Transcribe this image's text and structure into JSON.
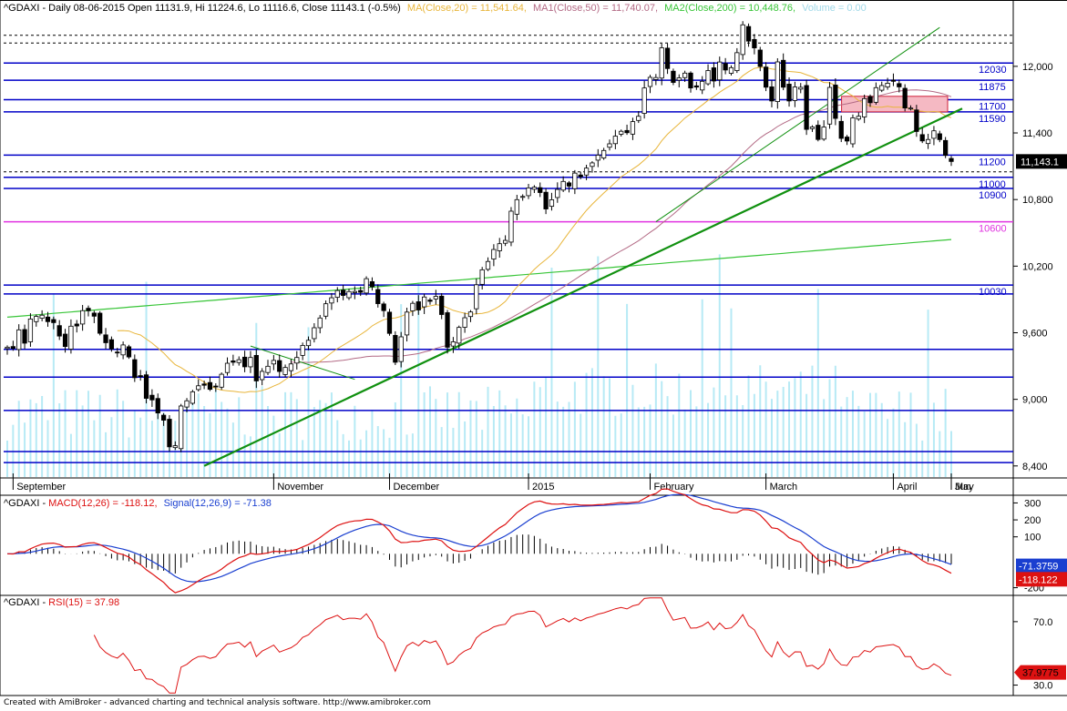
{
  "colors": {
    "up": "#ffffff",
    "down": "#000000",
    "ma20": "#e8b53a",
    "ma50": "#b36a85",
    "ma200": "#38c538",
    "volume": "#b7eaf5",
    "hline": "#0000c8",
    "magenta": "#e032e0",
    "trend": "#10900f",
    "zone": "#f5b9c3",
    "zone_border": "#d0203a",
    "macd": "#dd1111",
    "signal": "#1a3fd0",
    "rsi": "#dd1111"
  },
  "header": {
    "symbol": "^GDAXI - Daily 08-06-2015 Open 11131.9, Hi 11224.6, Lo 11116.6, Close 11143.1 (-0.5%)",
    "ma20": "MA(Close,20) = 11,541.64,",
    "ma50": "MA1(Close,50) = 11,740.07,",
    "ma200": "MA2(Close,200) = 10,448.76,",
    "volume": "Volume = 0.00"
  },
  "macd_header": {
    "prefix": "^GDAXI - ",
    "macd": "MACD(12,26) = -118.12,",
    "signal": "Signal(12,26,9) = -71.38"
  },
  "rsi_header": {
    "prefix": "^GDAXI - ",
    "rsi": "RSI(15) = 37.98"
  },
  "footer": "Created with AmiBroker - advanced charting and technical analysis software. http://www.amibroker.com",
  "chart_data": [
    {
      "type": "candlestick",
      "title": "^GDAXI - Daily 08-06-2015",
      "ylim": [
        8300,
        12450
      ],
      "y_ticks": [
        8400,
        9000,
        9600,
        10200,
        10800,
        11400,
        12000
      ],
      "y_tick_labels": [
        "8,400",
        "9,000",
        "9,600",
        "10,200",
        "10,800",
        "11,400",
        "12,000"
      ],
      "x_labels": [
        "September",
        "November",
        "December",
        "2015",
        "February",
        "March",
        "April",
        "May",
        "Jun"
      ],
      "last_price_label": "11,143.1",
      "last_price": 11143.1,
      "support_resistance": [
        {
          "value": 12030,
          "label": "12030"
        },
        {
          "value": 11875,
          "label": "11875"
        },
        {
          "value": 11700,
          "label": "11700"
        },
        {
          "value": 11590,
          "label": "11590"
        },
        {
          "value": 11200,
          "label": "11200"
        },
        {
          "value": 11000,
          "label": "11000"
        },
        {
          "value": 10900,
          "label": "10900"
        },
        {
          "value": 10600,
          "label": "10600"
        },
        {
          "value": 10030,
          "label": "10030"
        },
        {
          "value": 9950,
          "label": ""
        },
        {
          "value": 9450,
          "label": ""
        },
        {
          "value": 9200,
          "label": ""
        },
        {
          "value": 8900,
          "label": ""
        },
        {
          "value": 8530,
          "label": ""
        },
        {
          "value": 8430,
          "label": ""
        }
      ],
      "zone": [
        11590,
        11730
      ],
      "trendline": {
        "from": {
          "date": "2014-10-16",
          "value": 8400
        },
        "to": {
          "date": "2015-06-08",
          "value": 11570
        }
      },
      "trendline2": {
        "from": {
          "date": "2015-02-03",
          "value": 10600
        },
        "to": {
          "date": "2015-04-13",
          "value": 12350
        }
      },
      "closes_start": "2014-08-29",
      "closes": [
        9470,
        9459,
        9626,
        9506,
        9724,
        9747,
        9758,
        9700,
        9691,
        9570,
        9476,
        9659,
        9661,
        9799,
        9798,
        9749,
        9595,
        9510,
        9454,
        9422,
        9490,
        9382,
        9195,
        9209,
        9009,
        8995,
        8877,
        8812,
        8572,
        8582,
        8940,
        8987,
        9068,
        9122,
        9127,
        9090,
        9114,
        9226,
        9325,
        9334,
        9357,
        9293,
        9377,
        9166,
        9252,
        9298,
        9351,
        9251,
        9287,
        9319,
        9377,
        9486,
        9532,
        9645,
        9733,
        9861,
        9915,
        9980,
        9936,
        9971,
        9972,
        9964,
        10087,
        10014,
        9862,
        9799,
        9594,
        9334,
        9563,
        9786,
        9865,
        9805,
        9922,
        9883,
        9927,
        9764,
        9469,
        9518,
        9648,
        9735,
        9787,
        10032,
        10167,
        10242,
        10350,
        10402,
        10432,
        10695,
        10799,
        10828,
        10905,
        10911,
        10863,
        10715,
        10798,
        10891,
        10963,
        10921,
        11038,
        11005,
        11083,
        11130,
        11200,
        11242,
        11302,
        11371,
        11415,
        11402,
        11502,
        11550,
        11805,
        11901,
        11899,
        12167,
        11980,
        11855,
        11896,
        11939,
        11805,
        11813,
        11865,
        11962,
        11868,
        12039,
        11967,
        11988,
        12123,
        12374,
        12227,
        12166,
        11999,
        11812,
        11688,
        12040,
        11812,
        11688,
        11814,
        11811,
        11432,
        11454,
        11341,
        11453,
        11810,
        11531,
        11351,
        11327,
        11536,
        11550,
        11709,
        11672,
        11808,
        11827,
        11848,
        11865,
        11815,
        11625,
        11624,
        11413,
        11328,
        11341,
        11419,
        11340,
        11198,
        11143
      ],
      "volume_note": "Volume panel drawn as pale bars; volume values not printed"
    },
    {
      "type": "line",
      "title": "MACD(12,26)",
      "ylim": [
        -240,
        340
      ],
      "y_ticks": [
        300,
        200,
        100,
        -200
      ],
      "y_tick_labels": [
        "300",
        "200",
        "100",
        "-200"
      ],
      "series": [
        {
          "name": "MACD(12,26)",
          "last": -118.12
        },
        {
          "name": "Signal(12,26,9)",
          "last": -71.38
        }
      ],
      "last_labels": [
        "-71.3759",
        "-118.122"
      ]
    },
    {
      "type": "line",
      "title": "RSI(15)",
      "ylim": [
        24,
        86
      ],
      "y_ticks": [
        70,
        30
      ],
      "y_tick_labels": [
        "70.0",
        "30.0"
      ],
      "series": [
        {
          "name": "RSI(15)",
          "last": 37.98
        }
      ],
      "last_label": "37.9775"
    }
  ]
}
